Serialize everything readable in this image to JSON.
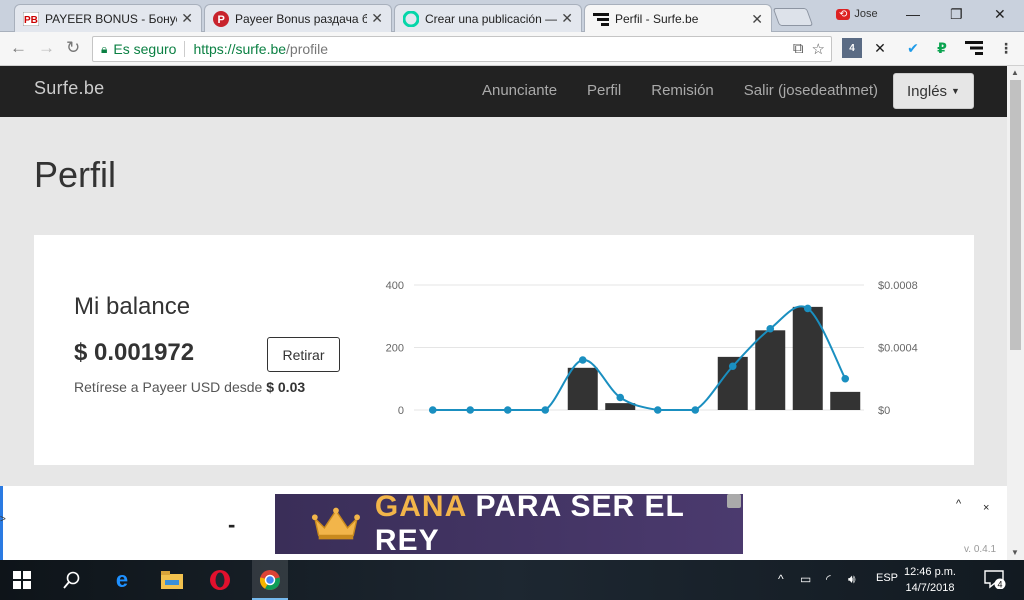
{
  "browser": {
    "tabs": [
      {
        "title": "PAYEER BONUS - Бонусы",
        "icon": "payeer-bonus-icon",
        "active": false
      },
      {
        "title": "Payeer Bonus раздача бо",
        "icon": "payeer-p-icon",
        "active": false
      },
      {
        "title": "Crear una publicación —",
        "icon": "steemit-icon",
        "active": false
      },
      {
        "title": "Perfil - Surfe.be",
        "icon": "surfe-icon",
        "active": true
      }
    ],
    "user_badge": "Jose",
    "security_label": "Es seguro",
    "url_host": "https://surfe.be",
    "url_path": "/profile",
    "extension_badge": "4"
  },
  "site": {
    "brand": "Surfe.be",
    "nav": [
      "Anunciante",
      "Perfil",
      "Remisión",
      "Salir (josedeathmet)"
    ],
    "language_button": "Inglés",
    "page_title": "Perfil"
  },
  "balance": {
    "title": "Mi balance",
    "amount": "$ 0.001972",
    "withdraw_label": "Retirar",
    "note_prefix": "Retírese a Payeer USD desde",
    "note_min": "$ 0.03"
  },
  "chart_data": {
    "type": "bar",
    "left_axis": {
      "ticks": [
        "400",
        "200",
        "0"
      ],
      "range": [
        0,
        400
      ]
    },
    "right_axis": {
      "ticks": [
        "$0.0008",
        "$0.0004",
        "$0"
      ],
      "range": [
        0,
        0.0008
      ]
    },
    "categories_count": 12,
    "bars": [
      0,
      0,
      0,
      0,
      135,
      22,
      0,
      0,
      170,
      255,
      330,
      58
    ],
    "line": [
      0,
      0,
      0,
      0,
      0.00032,
      8e-05,
      0,
      0,
      0.00028,
      0.00052,
      0.00065,
      0.0002
    ],
    "bar_color": "#333333",
    "line_color": "#1a8fc0",
    "grid": true
  },
  "ad": {
    "text_highlight": "GANA",
    "text_rest": "PARA SER EL REY",
    "dash": "-",
    "collapse_label": "^",
    "close_label": "×",
    "side_mark": ">",
    "version": "v. 0.4.1"
  },
  "taskbar": {
    "time": "12:46 p.m.",
    "date": "14/7/2018",
    "lang": "ESP",
    "notifications": "4"
  }
}
